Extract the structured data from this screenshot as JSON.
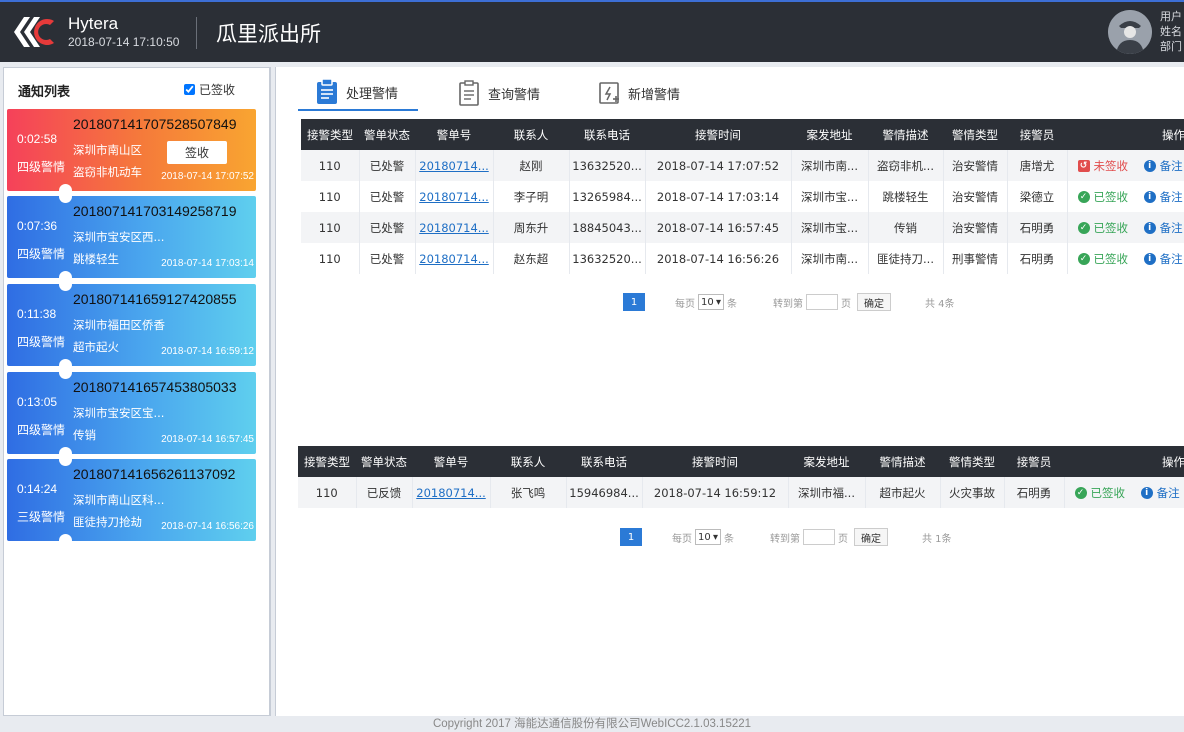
{
  "header": {
    "brand": "Hytera",
    "datetime": "2018-07-14 17:10:50",
    "station": "瓜里派出所",
    "user_lines": [
      "用户",
      "姓名",
      "部门"
    ]
  },
  "notify": {
    "title": "通知列表",
    "signed_label": "已签收",
    "sign_button": "签收",
    "cards": [
      {
        "elapsed": "0:02:58",
        "level": "四级警情",
        "alarm_no": "201807141707528507849",
        "addr": "深圳市南山区",
        "desc": "盗窃非机动车",
        "time": "2018-07-14 17:07:52",
        "color": "orange",
        "show_sign": true
      },
      {
        "elapsed": "0:07:36",
        "level": "四级警情",
        "alarm_no": "201807141703149258719",
        "addr": "深圳市宝安区西...",
        "desc": "跳楼轻生",
        "time": "2018-07-14 17:03:14",
        "color": "blue",
        "show_sign": false
      },
      {
        "elapsed": "0:11:38",
        "level": "四级警情",
        "alarm_no": "201807141659127420855",
        "addr": "深圳市福田区侨香",
        "desc": "超市起火",
        "time": "2018-07-14 16:59:12",
        "color": "blue",
        "show_sign": false
      },
      {
        "elapsed": "0:13:05",
        "level": "四级警情",
        "alarm_no": "201807141657453805033",
        "addr": "深圳市宝安区宝...",
        "desc": "传销",
        "time": "2018-07-14 16:57:45",
        "color": "blue",
        "show_sign": false
      },
      {
        "elapsed": "0:14:24",
        "level": "三级警情",
        "alarm_no": "201807141656261137092",
        "addr": "深圳市南山区科...",
        "desc": "匪徒持刀抢劫",
        "time": "2018-07-14 16:56:26",
        "color": "blue",
        "show_sign": false
      }
    ]
  },
  "tabs": [
    {
      "label": "处理警情",
      "icon": "clipboard-icon",
      "active": true
    },
    {
      "label": "查询警情",
      "icon": "document-search-icon",
      "active": false
    },
    {
      "label": "新增警情",
      "icon": "add-alarm-icon",
      "active": false
    }
  ],
  "table_columns": [
    "接警类型",
    "警单状态",
    "警单号",
    "联系人",
    "联系电话",
    "接警时间",
    "案发地址",
    "警情描述",
    "警情类型",
    "接警员",
    "操作"
  ],
  "table1": {
    "rows": [
      {
        "type": "110",
        "status": "已处警",
        "no": "20180714...",
        "contact": "赵刚",
        "phone": "13632520...",
        "time": "2018-07-14 17:07:52",
        "addr": "深圳市南...",
        "desc": "盗窃非机...",
        "category": "治安警情",
        "operator": "唐增尤",
        "sign": "未签收",
        "signed": false,
        "note": "备注"
      },
      {
        "type": "110",
        "status": "已处警",
        "no": "20180714...",
        "contact": "李子明",
        "phone": "13265984...",
        "time": "2018-07-14 17:03:14",
        "addr": "深圳市宝...",
        "desc": "跳楼轻生",
        "category": "治安警情",
        "operator": "梁德立",
        "sign": "已签收",
        "signed": true,
        "note": "备注"
      },
      {
        "type": "110",
        "status": "已处警",
        "no": "20180714...",
        "contact": "周东升",
        "phone": "18845043...",
        "time": "2018-07-14 16:57:45",
        "addr": "深圳市宝...",
        "desc": "传销",
        "category": "治安警情",
        "operator": "石明勇",
        "sign": "已签收",
        "signed": true,
        "note": "备注"
      },
      {
        "type": "110",
        "status": "已处警",
        "no": "20180714...",
        "contact": "赵东超",
        "phone": "13632520...",
        "time": "2018-07-14 16:56:26",
        "addr": "深圳市南...",
        "desc": "匪徒持刀...",
        "category": "刑事警情",
        "operator": "石明勇",
        "sign": "已签收",
        "signed": true,
        "note": "备注"
      }
    ],
    "pager": {
      "page": "1",
      "per_page_label": "每页",
      "per_page": "10",
      "unit": "条",
      "goto_label": "转到第",
      "page_unit": "页",
      "confirm": "确定",
      "total": "共 4条"
    }
  },
  "table2": {
    "rows": [
      {
        "type": "110",
        "status": "已反馈",
        "no": "20180714...",
        "contact": "张飞鸣",
        "phone": "15946984...",
        "time": "2018-07-14 16:59:12",
        "addr": "深圳市福...",
        "desc": "超市起火",
        "category": "火灾事故",
        "operator": "石明勇",
        "sign": "已签收",
        "signed": true,
        "note": "备注"
      }
    ],
    "pager": {
      "page": "1",
      "per_page_label": "每页",
      "per_page": "10",
      "unit": "条",
      "goto_label": "转到第",
      "page_unit": "页",
      "confirm": "确定",
      "total": "共 1条"
    }
  },
  "footer": "Copyright 2017 海能达通信股份有限公司WebICC2.1.03.15221",
  "colors": {
    "header_bg": "#2b2f36",
    "accent": "#2b7ad6",
    "danger": "#e14d4d",
    "success": "#38a558"
  }
}
